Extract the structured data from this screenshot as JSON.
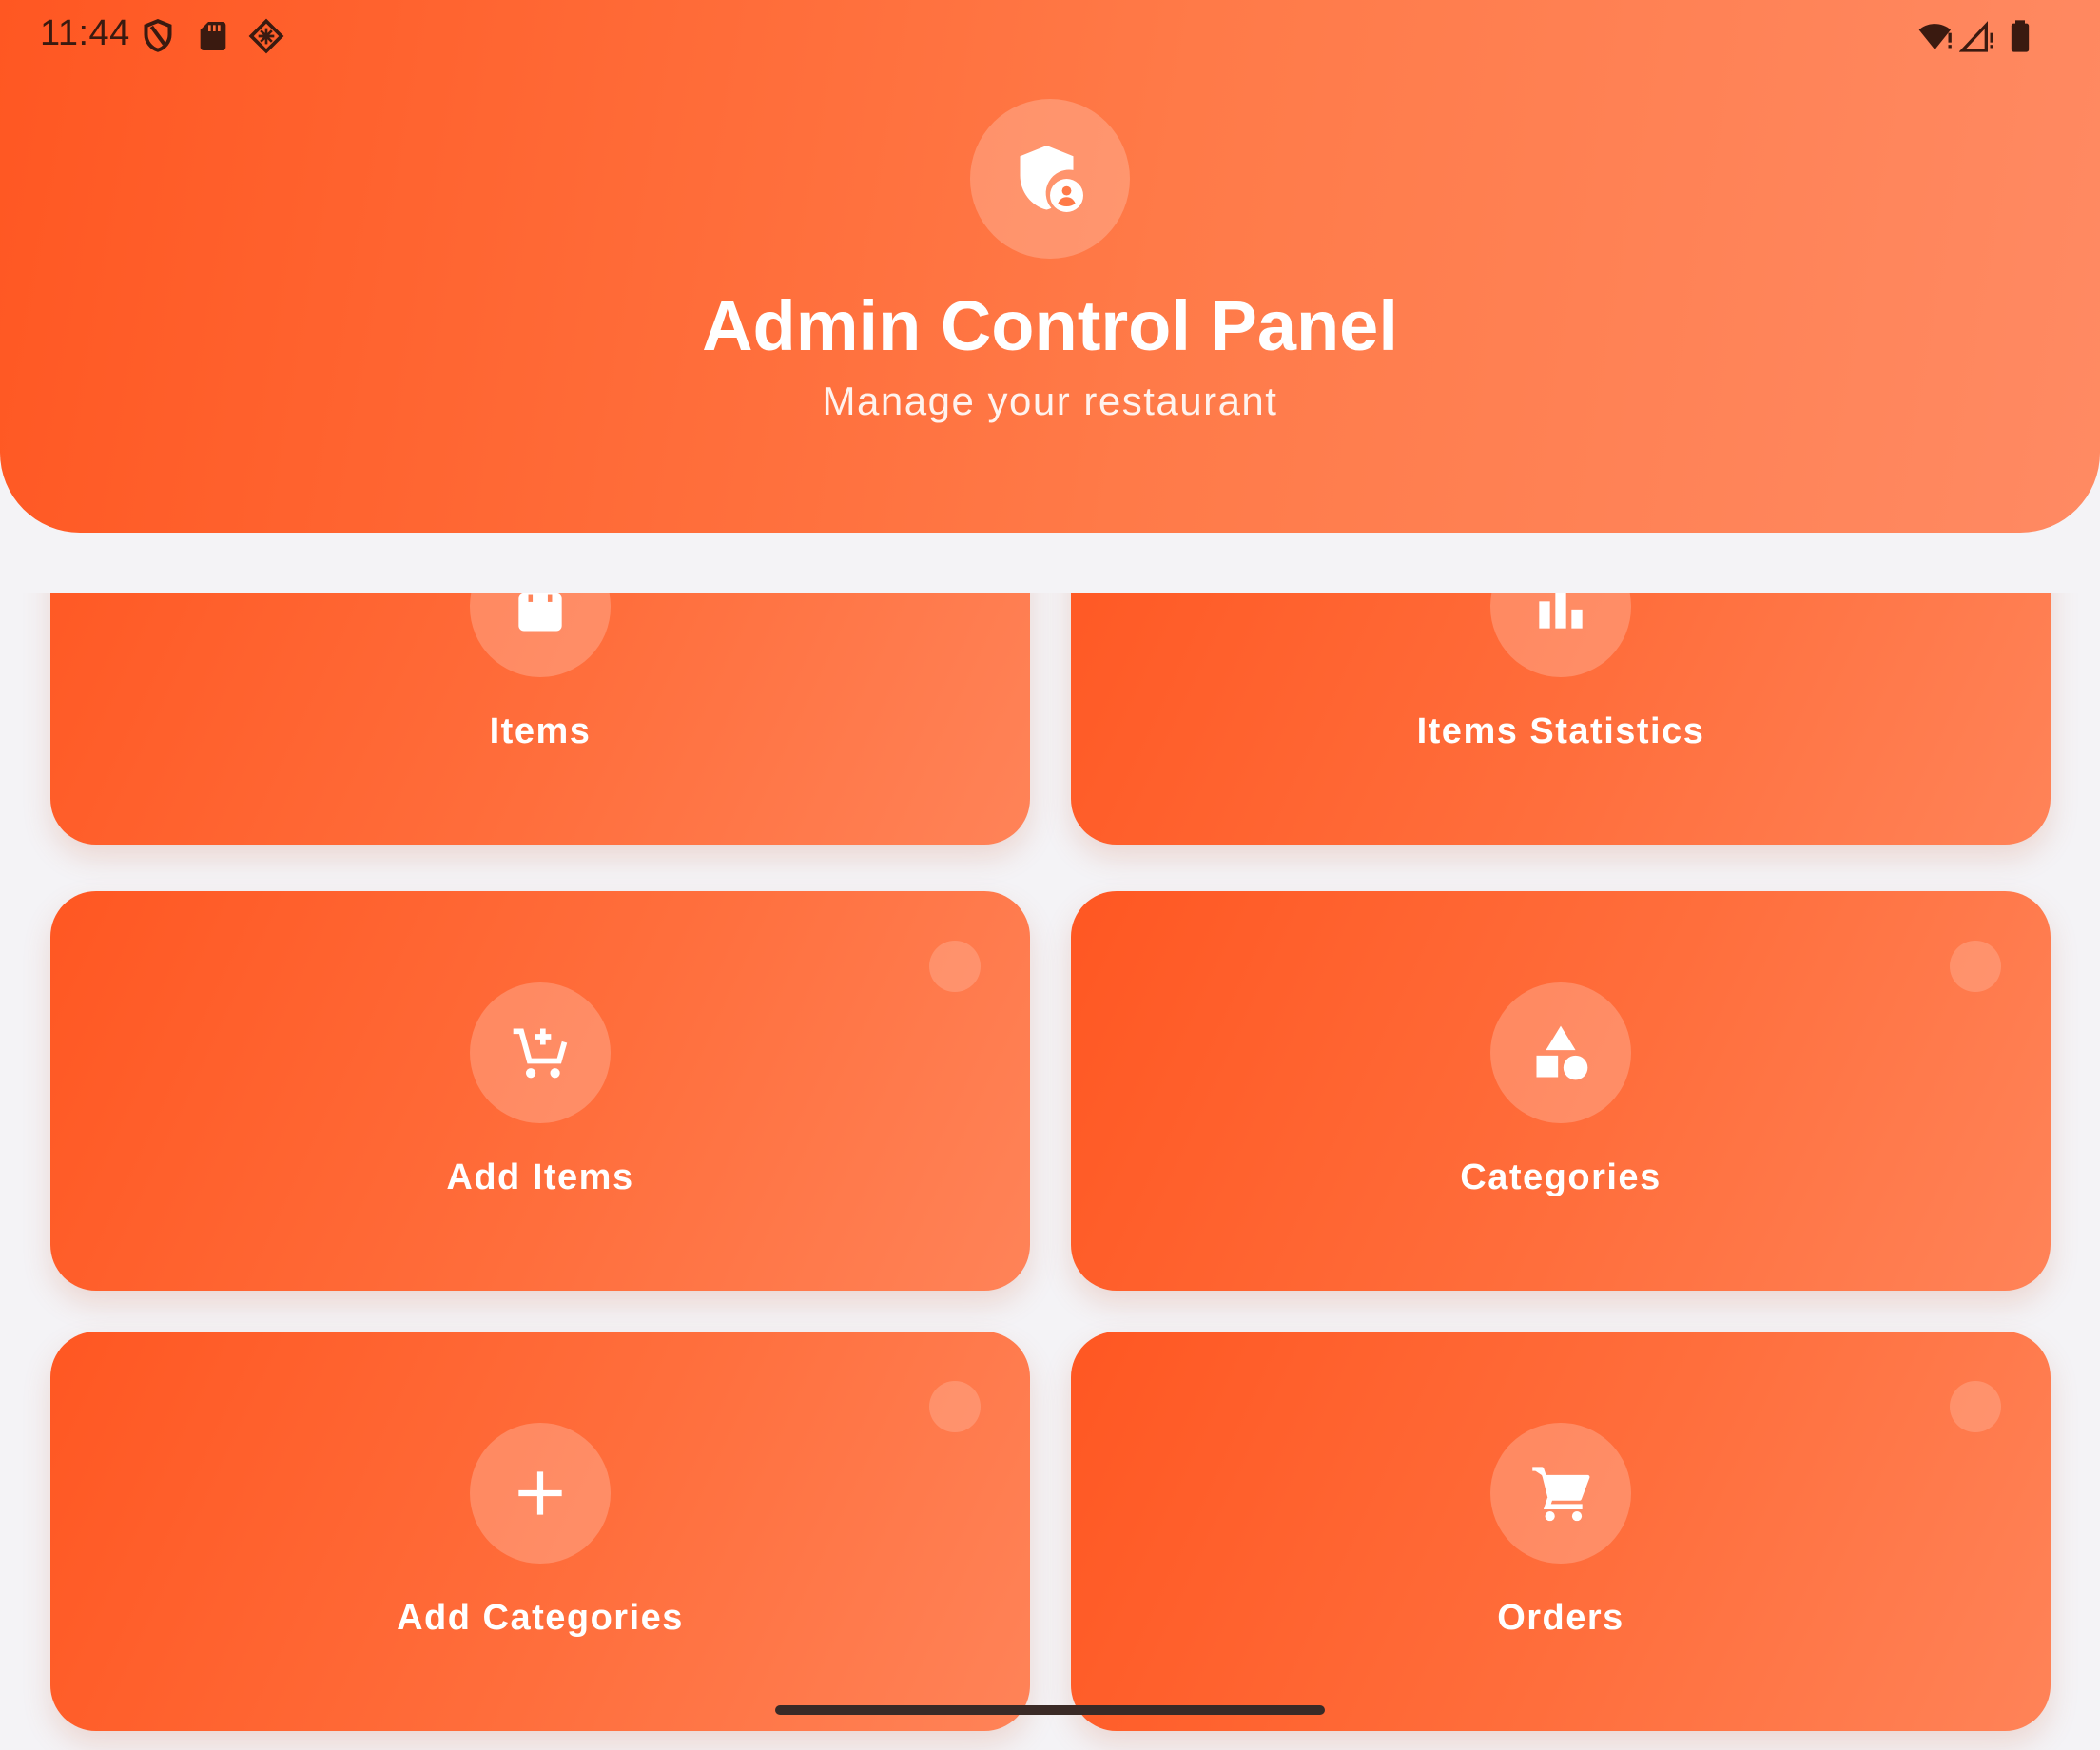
{
  "status_bar": {
    "time": "11:44",
    "left_icons": [
      "vpn-shield-icon",
      "sd-card-icon",
      "debug-icon"
    ],
    "right_icons": [
      "wifi-alert-icon",
      "signal-alert-icon",
      "battery-icon"
    ]
  },
  "header": {
    "icon": "admin-shield-icon",
    "title": "Admin Control Panel",
    "subtitle": "Manage your restaurant"
  },
  "menu": {
    "items": [
      {
        "label": "Items",
        "icon": "shopping-bag-icon"
      },
      {
        "label": "Items Statistics",
        "icon": "bar-chart-icon"
      },
      {
        "label": "Add Items",
        "icon": "add-to-cart-icon"
      },
      {
        "label": "Categories",
        "icon": "shapes-icon"
      },
      {
        "label": "Add Categories",
        "icon": "plus-icon"
      },
      {
        "label": "Orders",
        "icon": "shopping-cart-icon"
      }
    ]
  },
  "colors": {
    "primary": "#ff5722",
    "primary_light": "#ff8a63",
    "background": "#f4f3f6",
    "text_on_primary": "#ffffff"
  }
}
